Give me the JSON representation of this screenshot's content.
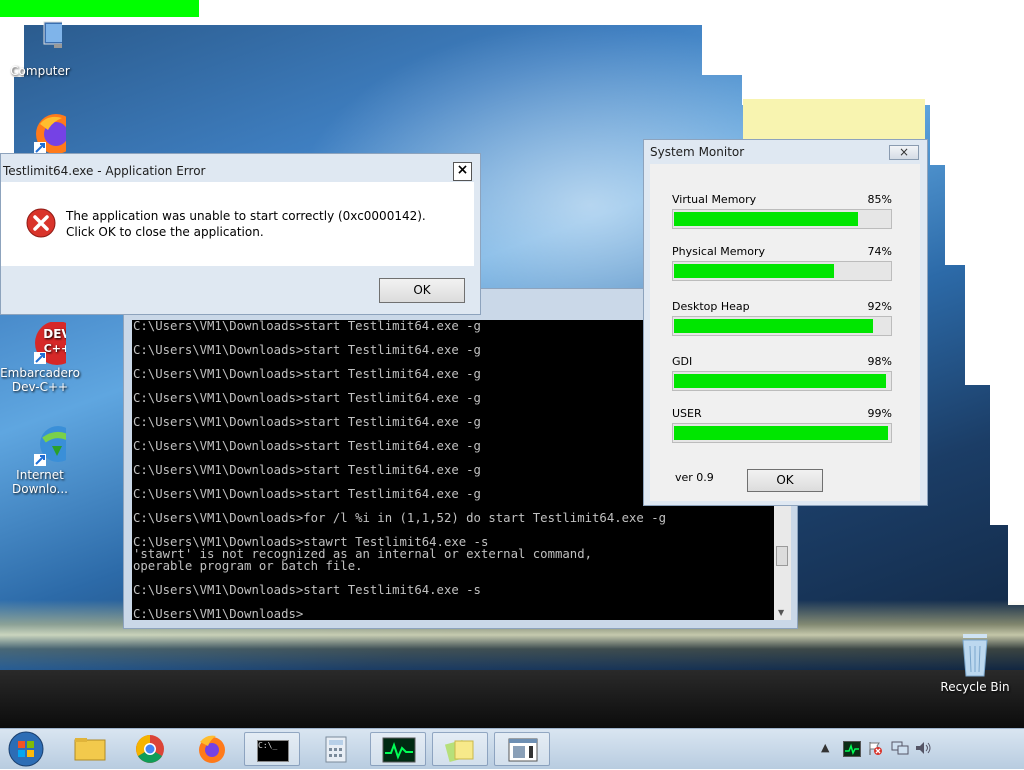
{
  "desktop": {
    "icons": [
      {
        "name": "computer",
        "label": "Computer"
      },
      {
        "name": "firefox",
        "label": ""
      },
      {
        "name": "devcpp",
        "label_lines": [
          "Embarcadero",
          "Dev-C++"
        ],
        "badge": [
          "DEV",
          "C++"
        ]
      },
      {
        "name": "idm",
        "label_lines": [
          "Internet",
          "Downlo..."
        ]
      },
      {
        "name": "recycle-bin",
        "label": "Recycle Bin"
      }
    ]
  },
  "error_dialog": {
    "title": "Testlimit64.exe - Application Error",
    "close_glyph": "×",
    "message": "The application was unable to start correctly (0xc0000142). Click OK to close the application.",
    "ok_label": "OK"
  },
  "cmd_window": {
    "lines": [
      "C:\\Users\\VM1\\Downloads>start Testlimit64.exe -g",
      "",
      "C:\\Users\\VM1\\Downloads>start Testlimit64.exe -g",
      "",
      "C:\\Users\\VM1\\Downloads>start Testlimit64.exe -g",
      "",
      "C:\\Users\\VM1\\Downloads>start Testlimit64.exe -g",
      "",
      "C:\\Users\\VM1\\Downloads>start Testlimit64.exe -g",
      "",
      "C:\\Users\\VM1\\Downloads>start Testlimit64.exe -g",
      "",
      "C:\\Users\\VM1\\Downloads>start Testlimit64.exe -g",
      "",
      "C:\\Users\\VM1\\Downloads>start Testlimit64.exe -g",
      "",
      "C:\\Users\\VM1\\Downloads>for /l %i in (1,1,52) do start Testlimit64.exe -g",
      "",
      "C:\\Users\\VM1\\Downloads>stawrt Testlimit64.exe -s",
      "'stawrt' is not recognized as an internal or external command,",
      "operable program or batch file.",
      "",
      "C:\\Users\\VM1\\Downloads>start Testlimit64.exe -s",
      "",
      "C:\\Users\\VM1\\Downloads>_"
    ]
  },
  "system_monitor": {
    "title": "System Monitor",
    "close_glyph": "×",
    "meters": [
      {
        "label": "Virtual Memory",
        "percent_text": "85%",
        "value": 85
      },
      {
        "label": "Physical Memory",
        "percent_text": "74%",
        "value": 74
      },
      {
        "label": "Desktop Heap",
        "percent_text": "92%",
        "value": 92
      },
      {
        "label": "GDI",
        "percent_text": "98%",
        "value": 98
      },
      {
        "label": "USER",
        "percent_text": "99%",
        "value": 99
      }
    ],
    "version": "ver 0.9",
    "ok_label": "OK"
  },
  "taskbar": {
    "cmd_icon_text": "C:\\_",
    "tray_chevron": "▲"
  },
  "colors": {
    "meter_fill": "#00e600",
    "top_progress": "#00ff00",
    "error_red": "#d9342b"
  }
}
